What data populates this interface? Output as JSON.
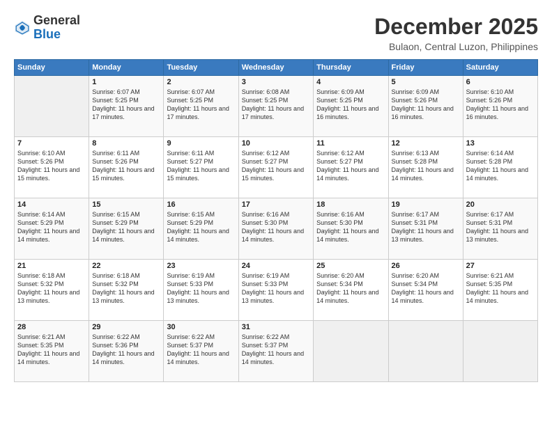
{
  "header": {
    "logo": {
      "general": "General",
      "blue": "Blue"
    },
    "title": "December 2025",
    "location": "Bulaon, Central Luzon, Philippines"
  },
  "days_of_week": [
    "Sunday",
    "Monday",
    "Tuesday",
    "Wednesday",
    "Thursday",
    "Friday",
    "Saturday"
  ],
  "weeks": [
    [
      {
        "day": "",
        "sunrise": "",
        "sunset": "",
        "daylight": "",
        "empty": true
      },
      {
        "day": "1",
        "sunrise": "6:07 AM",
        "sunset": "5:25 PM",
        "daylight": "11 hours and 17 minutes."
      },
      {
        "day": "2",
        "sunrise": "6:07 AM",
        "sunset": "5:25 PM",
        "daylight": "11 hours and 17 minutes."
      },
      {
        "day": "3",
        "sunrise": "6:08 AM",
        "sunset": "5:25 PM",
        "daylight": "11 hours and 17 minutes."
      },
      {
        "day": "4",
        "sunrise": "6:09 AM",
        "sunset": "5:25 PM",
        "daylight": "11 hours and 16 minutes."
      },
      {
        "day": "5",
        "sunrise": "6:09 AM",
        "sunset": "5:26 PM",
        "daylight": "11 hours and 16 minutes."
      },
      {
        "day": "6",
        "sunrise": "6:10 AM",
        "sunset": "5:26 PM",
        "daylight": "11 hours and 16 minutes."
      }
    ],
    [
      {
        "day": "7",
        "sunrise": "6:10 AM",
        "sunset": "5:26 PM",
        "daylight": "11 hours and 15 minutes."
      },
      {
        "day": "8",
        "sunrise": "6:11 AM",
        "sunset": "5:26 PM",
        "daylight": "11 hours and 15 minutes."
      },
      {
        "day": "9",
        "sunrise": "6:11 AM",
        "sunset": "5:27 PM",
        "daylight": "11 hours and 15 minutes."
      },
      {
        "day": "10",
        "sunrise": "6:12 AM",
        "sunset": "5:27 PM",
        "daylight": "11 hours and 15 minutes."
      },
      {
        "day": "11",
        "sunrise": "6:12 AM",
        "sunset": "5:27 PM",
        "daylight": "11 hours and 14 minutes."
      },
      {
        "day": "12",
        "sunrise": "6:13 AM",
        "sunset": "5:28 PM",
        "daylight": "11 hours and 14 minutes."
      },
      {
        "day": "13",
        "sunrise": "6:14 AM",
        "sunset": "5:28 PM",
        "daylight": "11 hours and 14 minutes."
      }
    ],
    [
      {
        "day": "14",
        "sunrise": "6:14 AM",
        "sunset": "5:29 PM",
        "daylight": "11 hours and 14 minutes."
      },
      {
        "day": "15",
        "sunrise": "6:15 AM",
        "sunset": "5:29 PM",
        "daylight": "11 hours and 14 minutes."
      },
      {
        "day": "16",
        "sunrise": "6:15 AM",
        "sunset": "5:29 PM",
        "daylight": "11 hours and 14 minutes."
      },
      {
        "day": "17",
        "sunrise": "6:16 AM",
        "sunset": "5:30 PM",
        "daylight": "11 hours and 14 minutes."
      },
      {
        "day": "18",
        "sunrise": "6:16 AM",
        "sunset": "5:30 PM",
        "daylight": "11 hours and 14 minutes."
      },
      {
        "day": "19",
        "sunrise": "6:17 AM",
        "sunset": "5:31 PM",
        "daylight": "11 hours and 13 minutes."
      },
      {
        "day": "20",
        "sunrise": "6:17 AM",
        "sunset": "5:31 PM",
        "daylight": "11 hours and 13 minutes."
      }
    ],
    [
      {
        "day": "21",
        "sunrise": "6:18 AM",
        "sunset": "5:32 PM",
        "daylight": "11 hours and 13 minutes."
      },
      {
        "day": "22",
        "sunrise": "6:18 AM",
        "sunset": "5:32 PM",
        "daylight": "11 hours and 13 minutes."
      },
      {
        "day": "23",
        "sunrise": "6:19 AM",
        "sunset": "5:33 PM",
        "daylight": "11 hours and 13 minutes."
      },
      {
        "day": "24",
        "sunrise": "6:19 AM",
        "sunset": "5:33 PM",
        "daylight": "11 hours and 13 minutes."
      },
      {
        "day": "25",
        "sunrise": "6:20 AM",
        "sunset": "5:34 PM",
        "daylight": "11 hours and 14 minutes."
      },
      {
        "day": "26",
        "sunrise": "6:20 AM",
        "sunset": "5:34 PM",
        "daylight": "11 hours and 14 minutes."
      },
      {
        "day": "27",
        "sunrise": "6:21 AM",
        "sunset": "5:35 PM",
        "daylight": "11 hours and 14 minutes."
      }
    ],
    [
      {
        "day": "28",
        "sunrise": "6:21 AM",
        "sunset": "5:35 PM",
        "daylight": "11 hours and 14 minutes."
      },
      {
        "day": "29",
        "sunrise": "6:22 AM",
        "sunset": "5:36 PM",
        "daylight": "11 hours and 14 minutes."
      },
      {
        "day": "30",
        "sunrise": "6:22 AM",
        "sunset": "5:37 PM",
        "daylight": "11 hours and 14 minutes."
      },
      {
        "day": "31",
        "sunrise": "6:22 AM",
        "sunset": "5:37 PM",
        "daylight": "11 hours and 14 minutes."
      },
      {
        "day": "",
        "sunrise": "",
        "sunset": "",
        "daylight": "",
        "empty": true
      },
      {
        "day": "",
        "sunrise": "",
        "sunset": "",
        "daylight": "",
        "empty": true
      },
      {
        "day": "",
        "sunrise": "",
        "sunset": "",
        "daylight": "",
        "empty": true
      }
    ]
  ],
  "labels": {
    "sunrise": "Sunrise:",
    "sunset": "Sunset:",
    "daylight": "Daylight:"
  }
}
